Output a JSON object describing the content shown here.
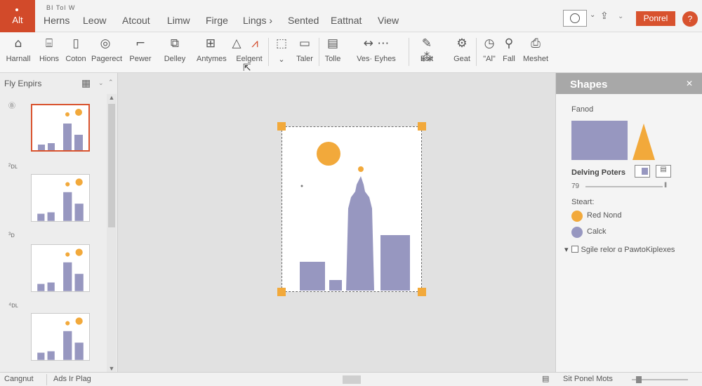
{
  "app": {
    "button_label": "Alt"
  },
  "menu": {
    "top_strip": "BI  Tol  W",
    "items": [
      "Herns",
      "Leow",
      "Atcout",
      "Limw",
      "Firge",
      "Lings ›",
      "Sented",
      "Eattnat",
      "View"
    ]
  },
  "command_bar": {
    "format_button": "Ponrel",
    "help_badge": "?"
  },
  "ribbon": {
    "buttons": [
      {
        "label": "Harnall",
        "icon": "home-icon"
      },
      {
        "label": "Hions",
        "icon": "building-icon"
      },
      {
        "label": "Coton",
        "icon": "page-icon"
      },
      {
        "label": "Pagerect",
        "icon": "palette-icon"
      },
      {
        "label": "Pewer",
        "icon": "pen-icon"
      },
      {
        "label": "Delley",
        "icon": "shapes-select-icon"
      },
      {
        "label": "Antymes",
        "icon": "grid-icon"
      },
      {
        "label": "Eelgent",
        "icon": "triangle-icon"
      },
      {
        "label": "",
        "icon": "comment-icon"
      },
      {
        "label": "Taler",
        "icon": "display-icon"
      },
      {
        "label": "Tolle",
        "icon": "table-icon"
      },
      {
        "label": "Ves· Eyhes",
        "icon": "arrows-icon"
      },
      {
        "label": "Eslt",
        "icon": "pencil-icon"
      },
      {
        "label": "Geat",
        "icon": "gear-icon"
      },
      {
        "label": "\"Al\"",
        "icon": "compass-icon"
      },
      {
        "label": "Fall",
        "icon": "stamp-icon"
      },
      {
        "label": "Meshet",
        "icon": "printer-icon"
      }
    ]
  },
  "thumbnails": {
    "title": "Fly Enpirs",
    "slides": [
      {
        "number": "Ⓑ",
        "selected": true
      },
      {
        "number": "²ᴅʟ",
        "selected": false
      },
      {
        "number": "³ᴅ",
        "selected": false
      },
      {
        "number": "⁴ᴅʟ",
        "selected": false
      }
    ]
  },
  "shapes_panel": {
    "title": "Shapes",
    "subtitle": "Fanod",
    "row_label": "Delving Poters",
    "slider_value": "79",
    "section_label": "Steart:",
    "legend": [
      {
        "label": "Red Nond",
        "color": "#f2a93b"
      },
      {
        "label": "Calck",
        "color": "#9797c0"
      }
    ],
    "checkbox_label": "Sgile relor ɑ PawtoKiplexes"
  },
  "status": {
    "left_text": "Cangnut",
    "mid_text": "Ads Ir Plag",
    "right_text": "Sit Ponel Mots"
  },
  "colors": {
    "accent": "#d8522e",
    "sun": "#f2a93b",
    "building": "#9797c0",
    "panel_header": "#a8a8a8"
  }
}
